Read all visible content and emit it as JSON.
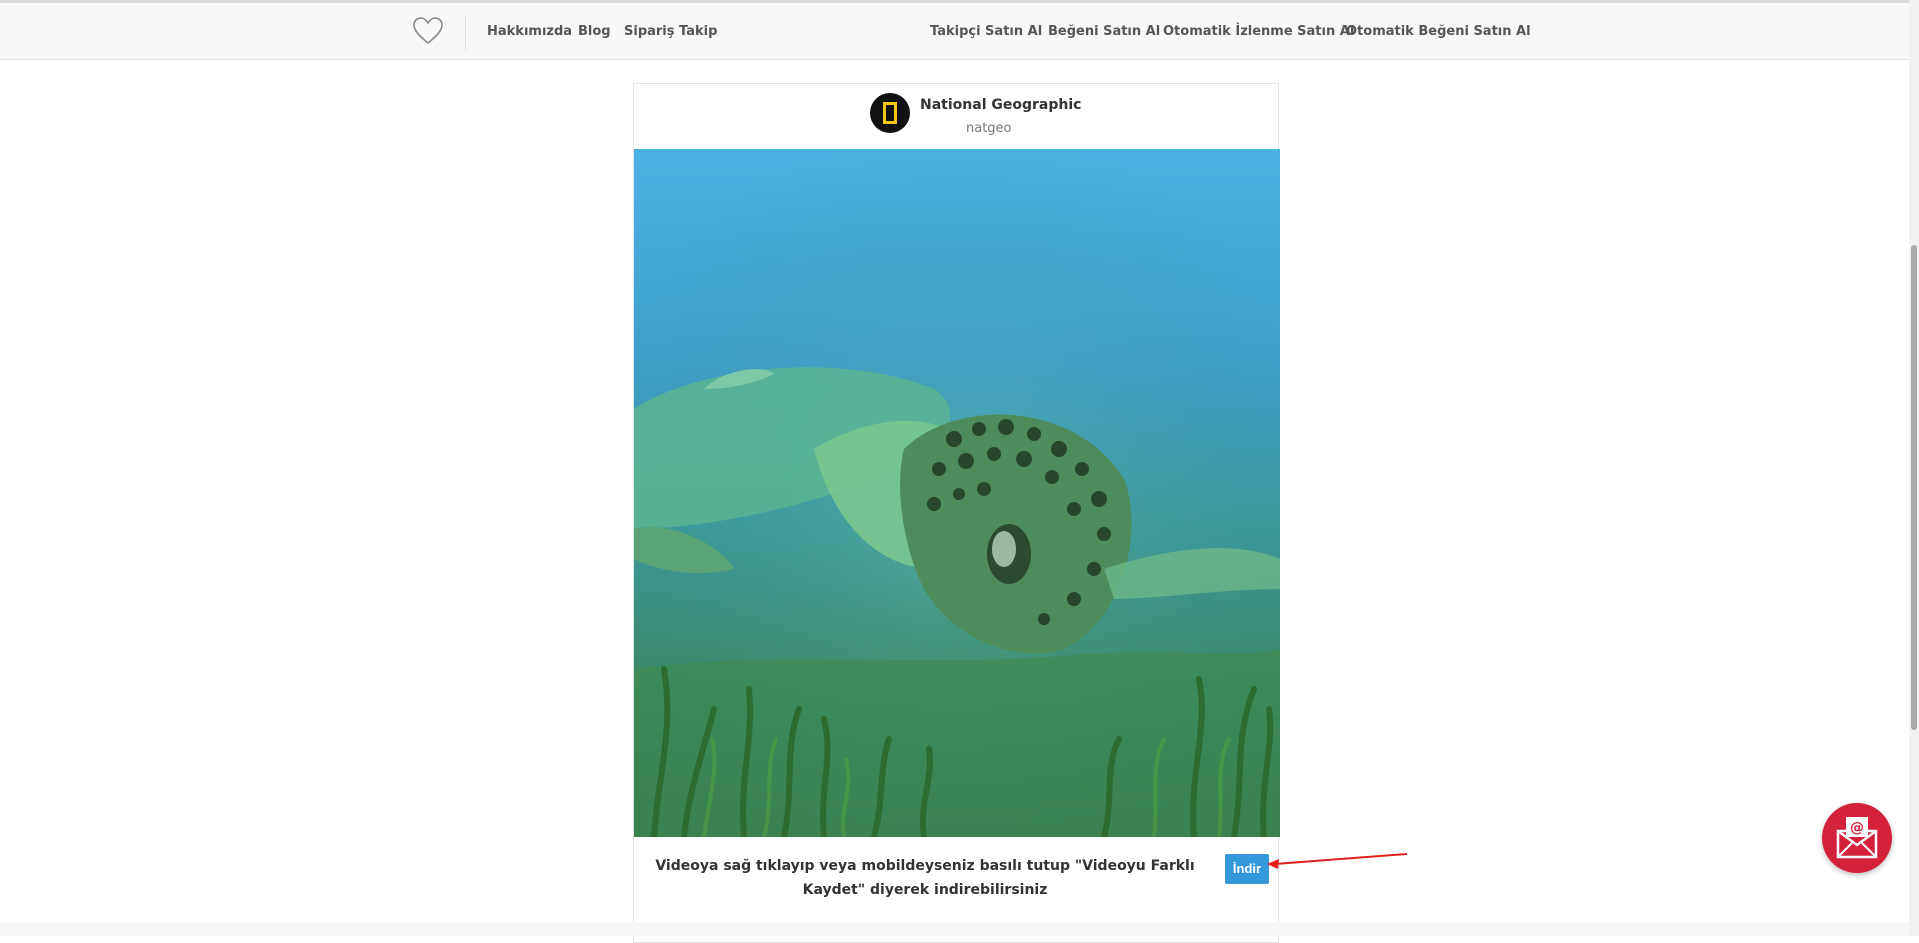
{
  "navbar": {
    "left_links": [
      "Hakkımızda",
      "Blog",
      "Sipariş Takip"
    ],
    "right_links": [
      "Takipçi Satın Al",
      "Beğeni Satın Al",
      "Otomatik İzlenme Satın Al",
      "Otomatik Beğeni Satın Al"
    ],
    "logo_icon": "heart-outline-icon"
  },
  "post": {
    "account_name": "National Geographic",
    "account_handle": "natgeo",
    "avatar_icon": "natgeo-yellow-frame-icon",
    "media": "sea-turtle-video"
  },
  "caption": {
    "text": "Videoya sağ tıklayıp veya mobildeyseniz basılı tutup \"Videoyu Farklı Kaydet\" diyerek indirebilirsiniz",
    "button_label": "İndir"
  },
  "colors": {
    "button": "#3498db",
    "fab": "#d3213a",
    "annotation_arrow": "#e0201b"
  },
  "fab": {
    "icon": "mail-envelope-at-icon"
  }
}
